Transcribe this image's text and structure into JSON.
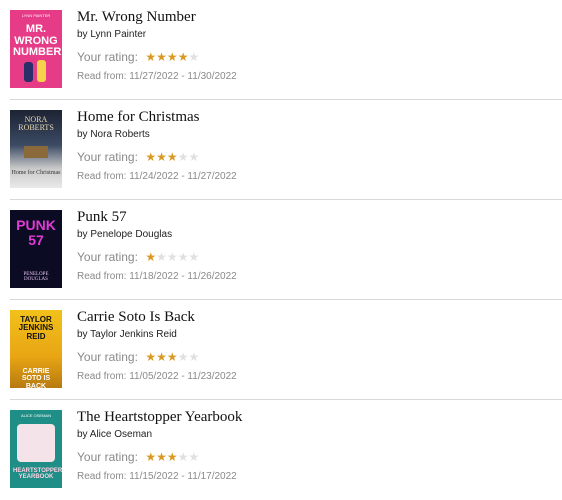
{
  "rating_label": "Your rating:",
  "books": [
    {
      "title": "Mr. Wrong Number",
      "author": "by Lynn Painter",
      "rating": 4,
      "read": "Read from: 11/27/2022 - 11/30/2022",
      "cover_text_top": "LYNN PAINTER",
      "cover_text_main": "MR. WRONG NUMBER"
    },
    {
      "title": "Home for Christmas",
      "author": "by Nora Roberts",
      "rating": 3,
      "read": "Read from: 11/24/2022 - 11/27/2022",
      "cover_text_top": "NORA ROBERTS",
      "cover_text_main": "Home for Christmas"
    },
    {
      "title": "Punk 57",
      "author": "by Penelope Douglas",
      "rating": 1,
      "read": "Read from: 11/18/2022 - 11/26/2022",
      "cover_text_top": "PUNK 57",
      "cover_text_main": "PENELOPE DOUGLAS"
    },
    {
      "title": "Carrie Soto Is Back",
      "author": "by Taylor Jenkins Reid",
      "rating": 3,
      "read": "Read from: 11/05/2022 - 11/23/2022",
      "cover_text_top": "TAYLOR JENKINS REID",
      "cover_text_main": "CARRIE SOTO IS BACK"
    },
    {
      "title": "The Heartstopper Yearbook",
      "author": "by Alice Oseman",
      "rating": 3,
      "read": "Read from: 11/15/2022 - 11/17/2022",
      "cover_text_top": "ALICE OSEMAN",
      "cover_text_main": "HEARTSTOPPER YEARBOOK"
    }
  ],
  "colors": {
    "star_on": "#d99a24",
    "star_off": "#e0e0e0"
  }
}
